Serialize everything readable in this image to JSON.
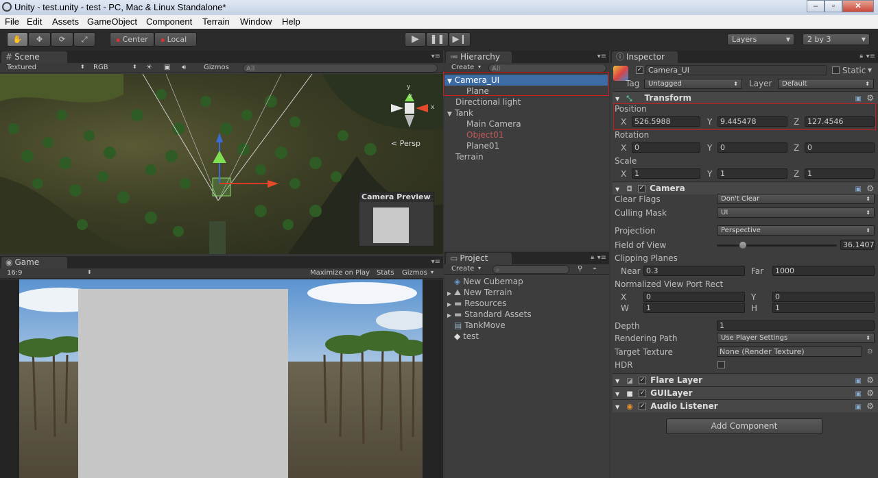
{
  "window": {
    "title": "Unity - test.unity - test - PC, Mac & Linux Standalone*",
    "controls": [
      "–",
      "▫",
      "✕"
    ]
  },
  "menu": [
    "File",
    "Edit",
    "Assets",
    "GameObject",
    "Component",
    "Terrain",
    "Window",
    "Help"
  ],
  "toolbar": {
    "pivot": "Center",
    "space": "Local",
    "layers": "Layers",
    "layout": "2 by 3",
    "icons": [
      "hand-icon",
      "move-icon",
      "rotate-icon",
      "scale-icon",
      "play-icon",
      "pause-icon",
      "step-icon"
    ]
  },
  "scene": {
    "tab": "Scene",
    "render_mode": "Textured",
    "color_mode": "RGB",
    "gizmos": "Gizmos",
    "search": "All",
    "persp": "< Persp",
    "camera_preview": "Camera Preview",
    "axes": {
      "x": "x",
      "y": "y",
      "z": "z"
    }
  },
  "game": {
    "tab": "Game",
    "aspect": "16:9",
    "maximize": "Maximize on Play",
    "stats": "Stats",
    "gizmos": "Gizmos"
  },
  "hierarchy": {
    "tab": "Hierarchy",
    "create": "Create",
    "search": "All",
    "items": [
      {
        "label": "Camera_UI",
        "arrow": "▼",
        "depth": 0,
        "selected": true
      },
      {
        "label": "Plane",
        "depth": 1
      },
      {
        "label": "Directional light",
        "depth": 0
      },
      {
        "label": "Tank",
        "arrow": "▼",
        "depth": 0
      },
      {
        "label": "Main Camera",
        "depth": 1
      },
      {
        "label": "Object01",
        "depth": 1,
        "color": "#c85a5a"
      },
      {
        "label": "Plane01",
        "depth": 1
      },
      {
        "label": "Terrain",
        "depth": 0
      }
    ]
  },
  "project": {
    "tab": "Project",
    "create": "Create",
    "items": [
      {
        "label": "New Cubemap",
        "icon": "cubemap-icon"
      },
      {
        "label": "New Terrain",
        "icon": "terrain-icon",
        "arrow": "▶"
      },
      {
        "label": "Resources",
        "icon": "folder-icon",
        "arrow": "▶"
      },
      {
        "label": "Standard Assets",
        "icon": "folder-icon",
        "arrow": "▶"
      },
      {
        "label": "TankMove",
        "icon": "script-icon"
      },
      {
        "label": "test",
        "icon": "unity-scene-icon"
      }
    ]
  },
  "inspector": {
    "tab": "Inspector",
    "object_name": "Camera_UI",
    "static": "Static",
    "tag_label": "Tag",
    "tag": "Untagged",
    "layer_label": "Layer",
    "layer": "Default",
    "transform": {
      "title": "Transform",
      "position_label": "Position",
      "rotation_label": "Rotation",
      "scale_label": "Scale",
      "axis": {
        "x": "X",
        "y": "Y",
        "z": "Z"
      },
      "position": {
        "x": "526.5988",
        "y": "9.445478",
        "z": "127.4546"
      },
      "rotation": {
        "x": "0",
        "y": "0",
        "z": "0"
      },
      "scale": {
        "x": "1",
        "y": "1",
        "z": "1"
      }
    },
    "camera": {
      "title": "Camera",
      "clear_flags_label": "Clear Flags",
      "clear_flags": "Don't Clear",
      "culling_mask_label": "Culling Mask",
      "culling_mask": "UI",
      "projection_label": "Projection",
      "projection": "Perspective",
      "fov_label": "Field of View",
      "fov": "36.1407",
      "fov_fraction": 0.2,
      "clipping_label": "Clipping Planes",
      "near_label": "Near",
      "near": "0.3",
      "far_label": "Far",
      "far": "1000",
      "viewport_label": "Normalized View Port Rect",
      "vp_x_label": "X",
      "vp_x": "0",
      "vp_y_label": "Y",
      "vp_y": "0",
      "vp_w_label": "W",
      "vp_w": "1",
      "vp_h_label": "H",
      "vp_h": "1",
      "depth_label": "Depth",
      "depth": "1",
      "rendering_path_label": "Rendering Path",
      "rendering_path": "Use Player Settings",
      "target_texture_label": "Target Texture",
      "target_texture": "None (Render Texture)",
      "hdr_label": "HDR"
    },
    "components": [
      "Flare Layer",
      "GUILayer",
      "Audio Listener"
    ],
    "add_component": "Add Component"
  }
}
